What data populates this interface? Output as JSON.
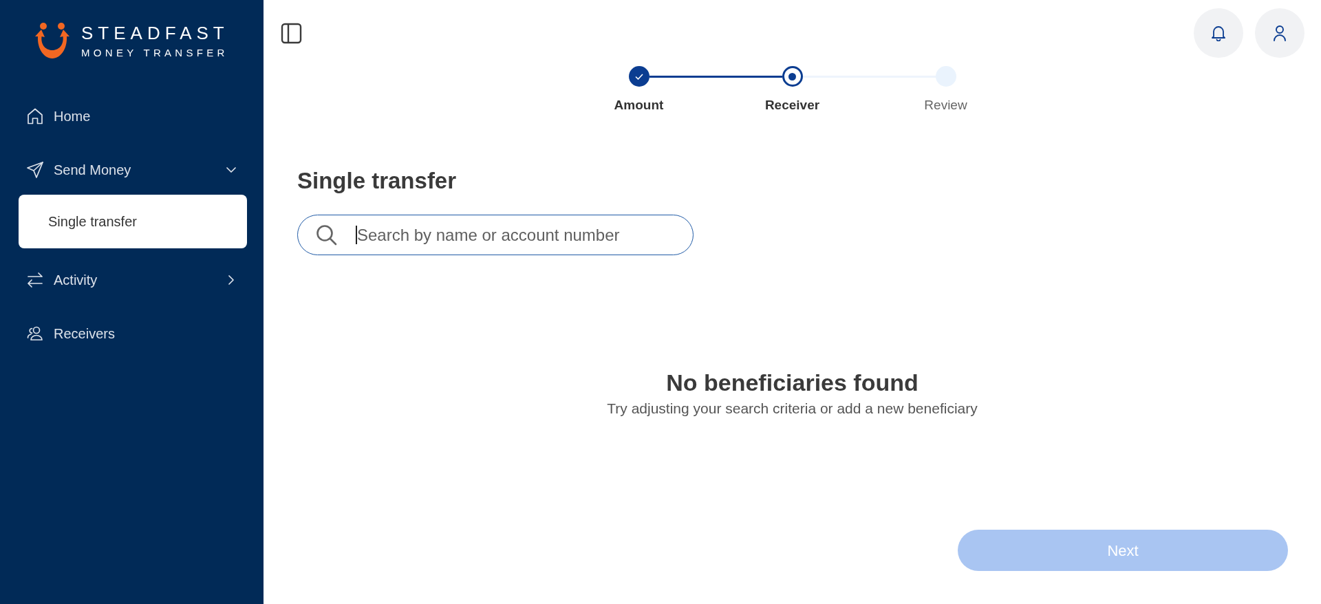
{
  "logo": {
    "name": "STEADFAST",
    "tagline": "MONEY TRANSFER"
  },
  "sidebar": {
    "items": [
      {
        "label": "Home",
        "selected": false
      },
      {
        "label": "Send Money",
        "selected": false,
        "expanded": true,
        "children": [
          {
            "label": "Single transfer",
            "selected": true
          }
        ]
      },
      {
        "label": "Activity",
        "selected": false,
        "expanded": false
      },
      {
        "label": "Receivers",
        "selected": false
      }
    ]
  },
  "stepper": {
    "steps": [
      {
        "label": "Amount",
        "completed": true,
        "selected": false
      },
      {
        "label": "Receiver",
        "completed": false,
        "selected": true
      },
      {
        "label": "Review",
        "completed": false,
        "selected": false
      }
    ]
  },
  "page": {
    "title": "Single transfer"
  },
  "search": {
    "placeholder": "Search by name or account number",
    "focused": true
  },
  "empty_state": {
    "title": "No beneficiaries found",
    "message": "Try adjusting your search criteria or add a new beneficiary"
  },
  "buttons": [
    {
      "label": "Next",
      "disabled": true
    }
  ]
}
